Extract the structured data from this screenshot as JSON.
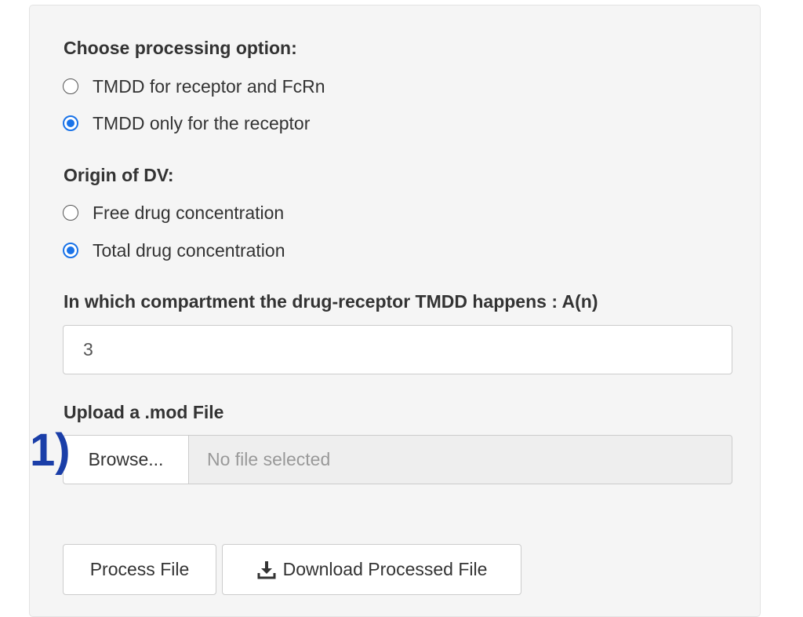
{
  "processing": {
    "label": "Choose processing option:",
    "options": [
      {
        "label": "TMDD for receptor and FcRn",
        "checked": false
      },
      {
        "label": "TMDD only for the receptor",
        "checked": true
      }
    ]
  },
  "origin": {
    "label": "Origin of DV:",
    "options": [
      {
        "label": "Free drug concentration",
        "checked": false
      },
      {
        "label": "Total drug concentration",
        "checked": true
      }
    ]
  },
  "compartment": {
    "label": "In which compartment the drug-receptor TMDD happens : A(n)",
    "value": "3"
  },
  "upload": {
    "label": "Upload a .mod File",
    "browse_label": "Browse...",
    "file_status": "No file selected"
  },
  "annotation": {
    "marker": "1)",
    "color": "#1a3ea8"
  },
  "actions": {
    "process_label": "Process File",
    "download_label": "Download Processed File",
    "download_icon": "download-icon"
  },
  "colors": {
    "radio_accent": "#1a73e8",
    "panel_bg": "#f5f5f5"
  }
}
